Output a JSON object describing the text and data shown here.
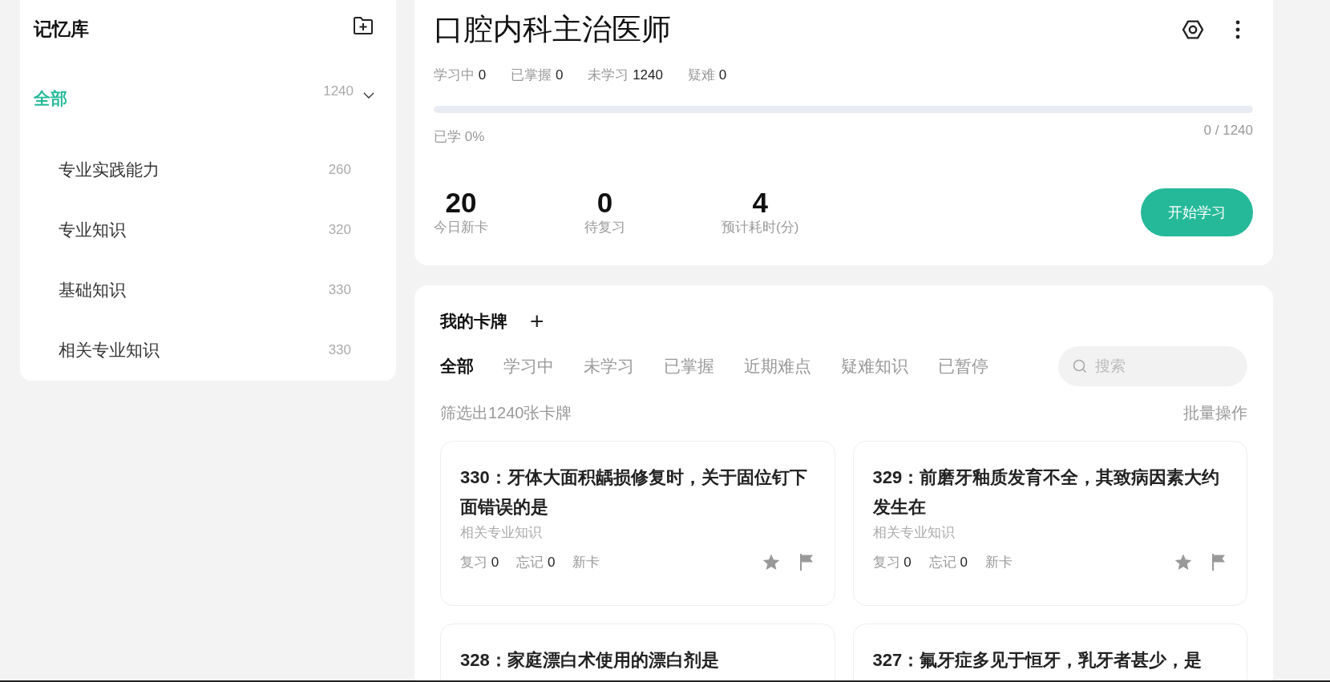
{
  "sidebar": {
    "title": "记忆库",
    "root": {
      "label": "全部",
      "count": "1240",
      "selected": true,
      "expanded": true,
      "children": [
        {
          "label": "专业实践能力",
          "count": "260",
          "selected": false
        },
        {
          "label": "专业知识",
          "count": "320",
          "selected": false
        },
        {
          "label": "基础知识",
          "count": "330",
          "selected": false
        },
        {
          "label": "相关专业知识",
          "count": "330",
          "selected": false
        }
      ]
    }
  },
  "deck": {
    "title": "口腔内科主治医师",
    "stats": [
      {
        "label": "学习中",
        "value": "0"
      },
      {
        "label": "已掌握",
        "value": "0"
      },
      {
        "label": "未学习",
        "value": "1240"
      },
      {
        "label": "疑难",
        "value": "0"
      }
    ],
    "progress": {
      "level": 0,
      "label": "已学 0%",
      "reading": "0 / 1240"
    },
    "today": [
      {
        "value": "20",
        "label": "今日新卡"
      },
      {
        "value": "0",
        "label": "待复习"
      },
      {
        "value": "4",
        "label": "预计耗时(分)"
      }
    ],
    "start_button": "开始学习"
  },
  "cards_panel": {
    "title": "我的卡牌",
    "add_icon": "+",
    "tabs": [
      {
        "label": "全部",
        "selected": true
      },
      {
        "label": "学习中",
        "selected": false
      },
      {
        "label": "未学习",
        "selected": false
      },
      {
        "label": "已掌握",
        "selected": false
      },
      {
        "label": "近期难点",
        "selected": false
      },
      {
        "label": "疑难知识",
        "selected": false
      },
      {
        "label": "已暂停",
        "selected": false
      }
    ],
    "search": {
      "placeholder": "搜索"
    },
    "filter_count": "筛选出1240张卡牌",
    "batch": "批量操作",
    "cards": [
      {
        "title": "330：牙体大面积龋损修复时，关于固位钉下面错误的是",
        "category": "相关专业知识",
        "review": "复习",
        "review_count": "0",
        "forget": "忘记",
        "forget_count": "0",
        "status": "新卡"
      },
      {
        "title": "329：前磨牙釉质发育不全，其致病因素大约发生在",
        "category": "相关专业知识",
        "review": "复习",
        "review_count": "0",
        "forget": "忘记",
        "forget_count": "0",
        "status": "新卡"
      },
      {
        "title": "328：家庭漂白术使用的漂白剂是"
      },
      {
        "title": "327：氟牙症多见于恒牙，乳牙者甚少，是"
      }
    ]
  }
}
